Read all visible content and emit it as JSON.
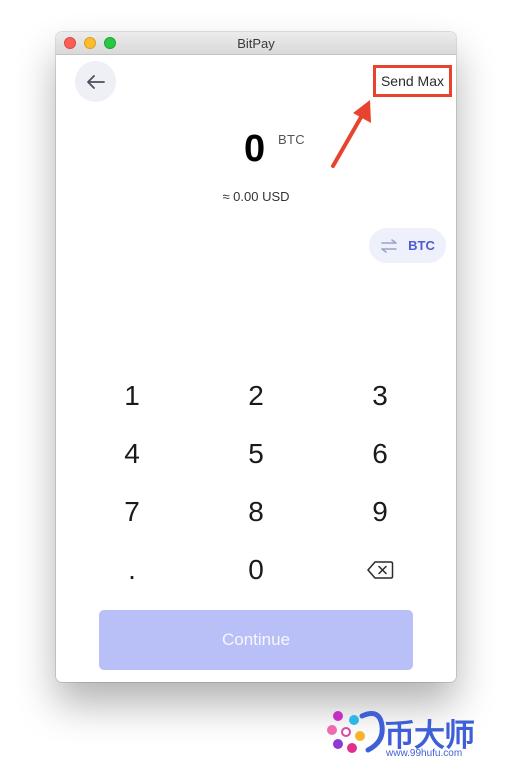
{
  "window": {
    "title": "BitPay"
  },
  "header": {
    "back_icon": "arrow-left-icon",
    "send_max_label": "Send Max"
  },
  "amount": {
    "value": "0",
    "unit": "BTC",
    "fiat": "≈ 0.00 USD"
  },
  "currency_toggle": {
    "icon": "swap-arrows-icon",
    "label": "BTC"
  },
  "keypad": {
    "keys": [
      "1",
      "2",
      "3",
      "4",
      "5",
      "6",
      "7",
      "8",
      "9",
      ".",
      "0"
    ],
    "backspace_icon": "backspace-icon"
  },
  "footer": {
    "continue_label": "Continue"
  },
  "watermark": {
    "text": "币大师",
    "url": "www.99hufu.com"
  },
  "colors": {
    "annotation": "#e8432e",
    "accent": "#4d5bcf",
    "continue_bg": "#b9c0f7"
  }
}
